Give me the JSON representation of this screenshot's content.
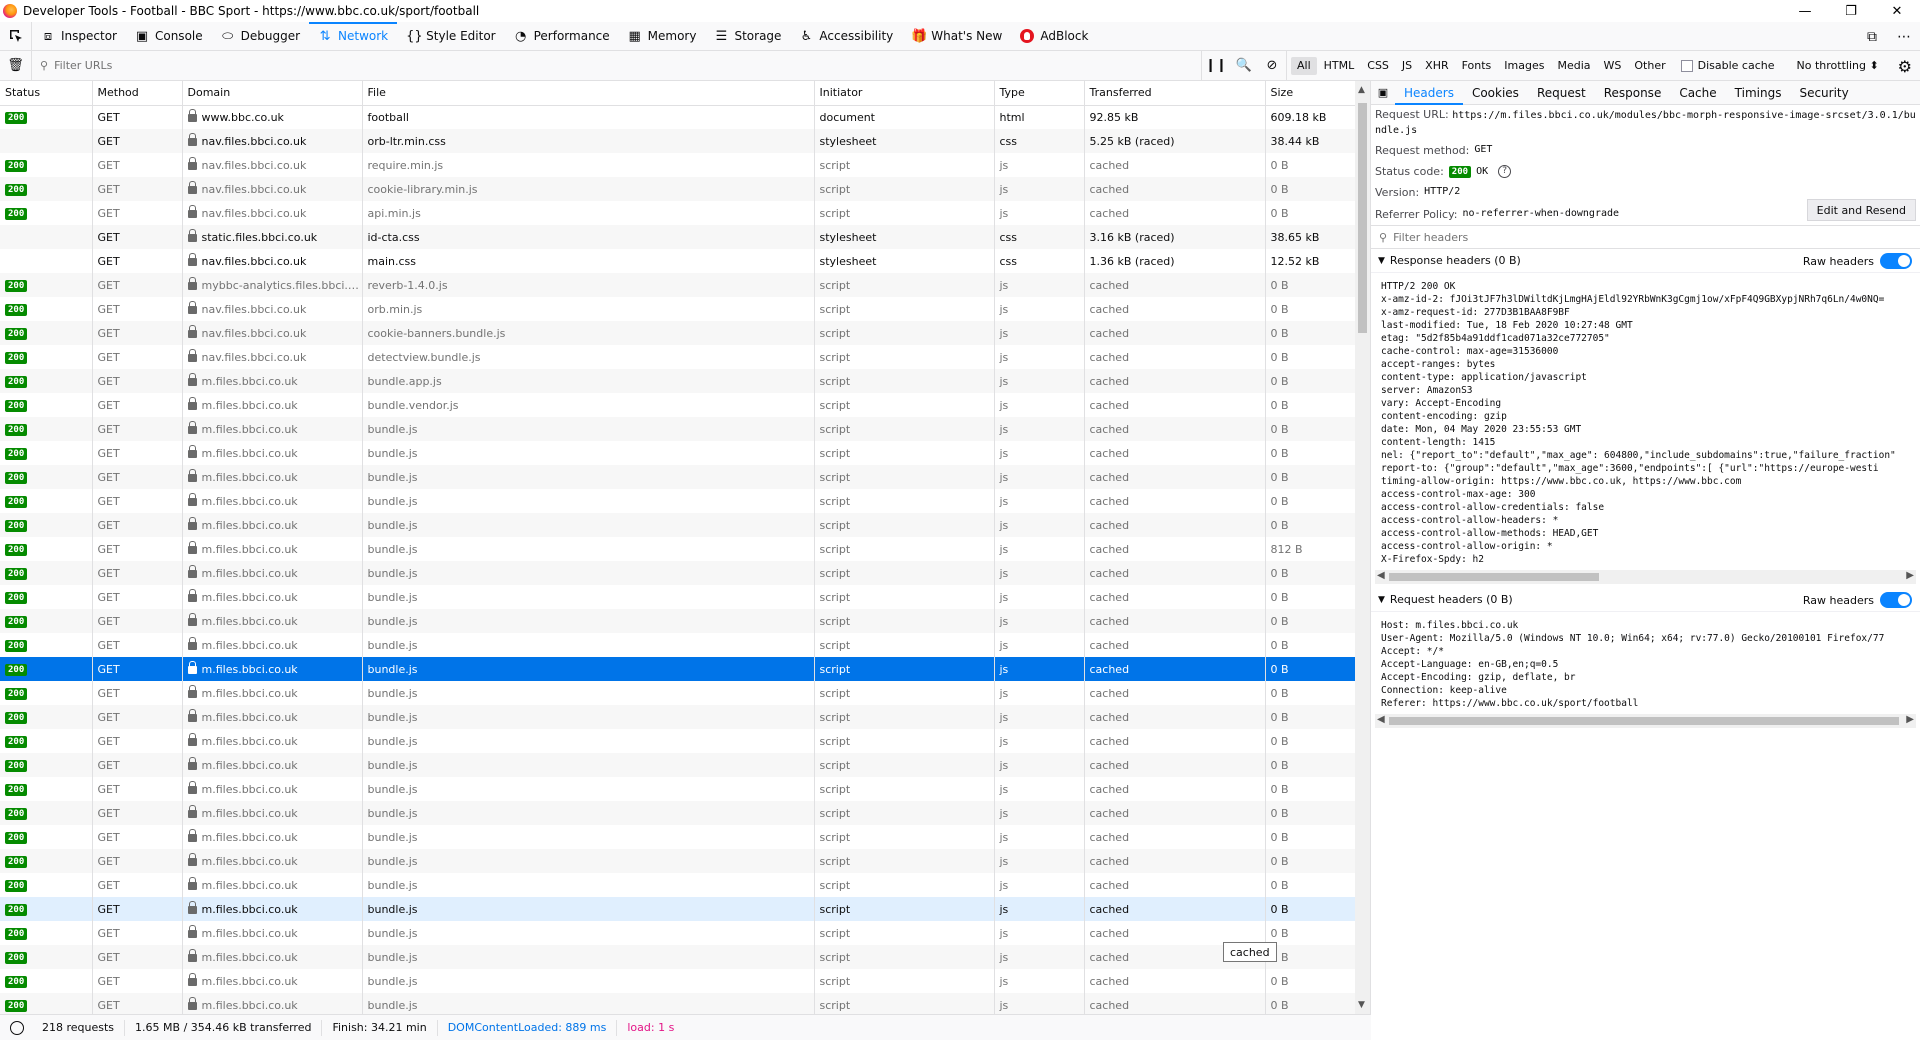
{
  "window": {
    "title": "Developer Tools - Football - BBC Sport - https://www.bbc.co.uk/sport/football",
    "minimize": "—",
    "restore": "❐",
    "close": "✕"
  },
  "toolbox": {
    "tabs": [
      {
        "label": "Inspector",
        "icon": "⧈"
      },
      {
        "label": "Console",
        "icon": "▣"
      },
      {
        "label": "Debugger",
        "icon": "⬭"
      },
      {
        "label": "Network",
        "icon": "⇅"
      },
      {
        "label": "Style Editor",
        "icon": "{}"
      },
      {
        "label": "Performance",
        "icon": "◔"
      },
      {
        "label": "Memory",
        "icon": "▦"
      },
      {
        "label": "Storage",
        "icon": "☰"
      },
      {
        "label": "Accessibility",
        "icon": "♿"
      },
      {
        "label": "What's New",
        "icon": "🎁"
      },
      {
        "label": "AdBlock",
        "icon": ""
      }
    ],
    "selected": "Network"
  },
  "network_toolbar": {
    "filter_placeholder": "Filter URLs",
    "types": [
      "All",
      "HTML",
      "CSS",
      "JS",
      "XHR",
      "Fonts",
      "Images",
      "Media",
      "WS",
      "Other"
    ],
    "active_type": "All",
    "disable_cache": "Disable cache",
    "throttling": "No throttling ⬍"
  },
  "columns": [
    "Status",
    "Method",
    "Domain",
    "File",
    "Initiator",
    "Type",
    "Transferred",
    "Size"
  ],
  "requests": [
    {
      "status": "200",
      "method": "GET",
      "domain": "www.bbc.co.uk",
      "file": "football",
      "initiator": "document",
      "type": "html",
      "transferred": "92.85 kB",
      "size": "609.18 kB",
      "fresh": true
    },
    {
      "status": "",
      "method": "GET",
      "domain": "nav.files.bbci.co.uk",
      "file": "orb-ltr.min.css",
      "initiator": "stylesheet",
      "type": "css",
      "transferred": "5.25 kB (raced)",
      "size": "38.44 kB",
      "fresh": true
    },
    {
      "status": "200",
      "method": "GET",
      "domain": "nav.files.bbci.co.uk",
      "file": "require.min.js",
      "initiator": "script",
      "type": "js",
      "transferred": "cached",
      "size": "0 B"
    },
    {
      "status": "200",
      "method": "GET",
      "domain": "nav.files.bbci.co.uk",
      "file": "cookie-library.min.js",
      "initiator": "script",
      "type": "js",
      "transferred": "cached",
      "size": "0 B"
    },
    {
      "status": "200",
      "method": "GET",
      "domain": "nav.files.bbci.co.uk",
      "file": "api.min.js",
      "initiator": "script",
      "type": "js",
      "transferred": "cached",
      "size": "0 B"
    },
    {
      "status": "",
      "method": "GET",
      "domain": "static.files.bbci.co.uk",
      "file": "id-cta.css",
      "initiator": "stylesheet",
      "type": "css",
      "transferred": "3.16 kB (raced)",
      "size": "38.65 kB",
      "fresh": true
    },
    {
      "status": "",
      "method": "GET",
      "domain": "nav.files.bbci.co.uk",
      "file": "main.css",
      "initiator": "stylesheet",
      "type": "css",
      "transferred": "1.36 kB (raced)",
      "size": "12.52 kB",
      "fresh": true
    },
    {
      "status": "200",
      "method": "GET",
      "domain": "mybbc-analytics.files.bbci.co...",
      "file": "reverb-1.4.0.js",
      "initiator": "script",
      "type": "js",
      "transferred": "cached",
      "size": "0 B"
    },
    {
      "status": "200",
      "method": "GET",
      "domain": "nav.files.bbci.co.uk",
      "file": "orb.min.js",
      "initiator": "script",
      "type": "js",
      "transferred": "cached",
      "size": "0 B"
    },
    {
      "status": "200",
      "method": "GET",
      "domain": "nav.files.bbci.co.uk",
      "file": "cookie-banners.bundle.js",
      "initiator": "script",
      "type": "js",
      "transferred": "cached",
      "size": "0 B"
    },
    {
      "status": "200",
      "method": "GET",
      "domain": "nav.files.bbci.co.uk",
      "file": "detectview.bundle.js",
      "initiator": "script",
      "type": "js",
      "transferred": "cached",
      "size": "0 B"
    },
    {
      "status": "200",
      "method": "GET",
      "domain": "m.files.bbci.co.uk",
      "file": "bundle.app.js",
      "initiator": "script",
      "type": "js",
      "transferred": "cached",
      "size": "0 B"
    },
    {
      "status": "200",
      "method": "GET",
      "domain": "m.files.bbci.co.uk",
      "file": "bundle.vendor.js",
      "initiator": "script",
      "type": "js",
      "transferred": "cached",
      "size": "0 B"
    },
    {
      "status": "200",
      "method": "GET",
      "domain": "m.files.bbci.co.uk",
      "file": "bundle.js",
      "initiator": "script",
      "type": "js",
      "transferred": "cached",
      "size": "0 B"
    },
    {
      "status": "200",
      "method": "GET",
      "domain": "m.files.bbci.co.uk",
      "file": "bundle.js",
      "initiator": "script",
      "type": "js",
      "transferred": "cached",
      "size": "0 B"
    },
    {
      "status": "200",
      "method": "GET",
      "domain": "m.files.bbci.co.uk",
      "file": "bundle.js",
      "initiator": "script",
      "type": "js",
      "transferred": "cached",
      "size": "0 B"
    },
    {
      "status": "200",
      "method": "GET",
      "domain": "m.files.bbci.co.uk",
      "file": "bundle.js",
      "initiator": "script",
      "type": "js",
      "transferred": "cached",
      "size": "0 B"
    },
    {
      "status": "200",
      "method": "GET",
      "domain": "m.files.bbci.co.uk",
      "file": "bundle.js",
      "initiator": "script",
      "type": "js",
      "transferred": "cached",
      "size": "0 B"
    },
    {
      "status": "200",
      "method": "GET",
      "domain": "m.files.bbci.co.uk",
      "file": "bundle.js",
      "initiator": "script",
      "type": "js",
      "transferred": "cached",
      "size": "812 B"
    },
    {
      "status": "200",
      "method": "GET",
      "domain": "m.files.bbci.co.uk",
      "file": "bundle.js",
      "initiator": "script",
      "type": "js",
      "transferred": "cached",
      "size": "0 B"
    },
    {
      "status": "200",
      "method": "GET",
      "domain": "m.files.bbci.co.uk",
      "file": "bundle.js",
      "initiator": "script",
      "type": "js",
      "transferred": "cached",
      "size": "0 B"
    },
    {
      "status": "200",
      "method": "GET",
      "domain": "m.files.bbci.co.uk",
      "file": "bundle.js",
      "initiator": "script",
      "type": "js",
      "transferred": "cached",
      "size": "0 B"
    },
    {
      "status": "200",
      "method": "GET",
      "domain": "m.files.bbci.co.uk",
      "file": "bundle.js",
      "initiator": "script",
      "type": "js",
      "transferred": "cached",
      "size": "0 B"
    },
    {
      "status": "200",
      "method": "GET",
      "domain": "m.files.bbci.co.uk",
      "file": "bundle.js",
      "initiator": "script",
      "type": "js",
      "transferred": "cached",
      "size": "0 B",
      "selected": true
    },
    {
      "status": "200",
      "method": "GET",
      "domain": "m.files.bbci.co.uk",
      "file": "bundle.js",
      "initiator": "script",
      "type": "js",
      "transferred": "cached",
      "size": "0 B"
    },
    {
      "status": "200",
      "method": "GET",
      "domain": "m.files.bbci.co.uk",
      "file": "bundle.js",
      "initiator": "script",
      "type": "js",
      "transferred": "cached",
      "size": "0 B"
    },
    {
      "status": "200",
      "method": "GET",
      "domain": "m.files.bbci.co.uk",
      "file": "bundle.js",
      "initiator": "script",
      "type": "js",
      "transferred": "cached",
      "size": "0 B"
    },
    {
      "status": "200",
      "method": "GET",
      "domain": "m.files.bbci.co.uk",
      "file": "bundle.js",
      "initiator": "script",
      "type": "js",
      "transferred": "cached",
      "size": "0 B"
    },
    {
      "status": "200",
      "method": "GET",
      "domain": "m.files.bbci.co.uk",
      "file": "bundle.js",
      "initiator": "script",
      "type": "js",
      "transferred": "cached",
      "size": "0 B"
    },
    {
      "status": "200",
      "method": "GET",
      "domain": "m.files.bbci.co.uk",
      "file": "bundle.js",
      "initiator": "script",
      "type": "js",
      "transferred": "cached",
      "size": "0 B"
    },
    {
      "status": "200",
      "method": "GET",
      "domain": "m.files.bbci.co.uk",
      "file": "bundle.js",
      "initiator": "script",
      "type": "js",
      "transferred": "cached",
      "size": "0 B"
    },
    {
      "status": "200",
      "method": "GET",
      "domain": "m.files.bbci.co.uk",
      "file": "bundle.js",
      "initiator": "script",
      "type": "js",
      "transferred": "cached",
      "size": "0 B"
    },
    {
      "status": "200",
      "method": "GET",
      "domain": "m.files.bbci.co.uk",
      "file": "bundle.js",
      "initiator": "script",
      "type": "js",
      "transferred": "cached",
      "size": "0 B"
    },
    {
      "status": "200",
      "method": "GET",
      "domain": "m.files.bbci.co.uk",
      "file": "bundle.js",
      "initiator": "script",
      "type": "js",
      "transferred": "cached",
      "size": "0 B",
      "hover": true
    },
    {
      "status": "200",
      "method": "GET",
      "domain": "m.files.bbci.co.uk",
      "file": "bundle.js",
      "initiator": "script",
      "type": "js",
      "transferred": "cached",
      "size": "0 B"
    },
    {
      "status": "200",
      "method": "GET",
      "domain": "m.files.bbci.co.uk",
      "file": "bundle.js",
      "initiator": "script",
      "type": "js",
      "transferred": "cached",
      "size": "0 B"
    },
    {
      "status": "200",
      "method": "GET",
      "domain": "m.files.bbci.co.uk",
      "file": "bundle.js",
      "initiator": "script",
      "type": "js",
      "transferred": "cached",
      "size": "0 B"
    },
    {
      "status": "200",
      "method": "GET",
      "domain": "m.files.bbci.co.uk",
      "file": "bundle.js",
      "initiator": "script",
      "type": "js",
      "transferred": "cached",
      "size": "0 B"
    }
  ],
  "tooltip": "cached",
  "statusbar": {
    "requests": "218 requests",
    "transferred": "1.65 MB / 354.46 kB transferred",
    "finish": "Finish: 34.21 min",
    "dom": "DOMContentLoaded: 889 ms",
    "load": "load: 1 s"
  },
  "side": {
    "tabs": [
      "Headers",
      "Cookies",
      "Request",
      "Response",
      "Cache",
      "Timings",
      "Security"
    ],
    "selected": "Headers",
    "request_url_label": "Request URL:",
    "request_url": "https://m.files.bbci.co.uk/modules/bbc-morph-responsive-image-srcset/3.0.1/bundle.js",
    "method_label": "Request method:",
    "method": "GET",
    "status_label": "Status code:",
    "status_code": "200",
    "status_text": "OK",
    "version_label": "Version:",
    "version": "HTTP/2",
    "referrer_label": "Referrer Policy:",
    "referrer": "no-referrer-when-downgrade",
    "edit_resend": "Edit and Resend",
    "filter_placeholder": "Filter headers",
    "response_title": "Response headers (0 B)",
    "request_title": "Request headers (0 B)",
    "raw_label": "Raw headers",
    "response_headers": [
      "HTTP/2 200 OK",
      "x-amz-id-2: fJOi3tJF7h3lDWiltdKjLmgHAjEldl92YRbWnK3gCgmj1ow/xFpF4Q9GBXypjNRh7q6Ln/4w0NQ=",
      "x-amz-request-id: 277D3B1BAA8F9BF",
      "last-modified: Tue, 18 Feb 2020 10:27:48 GMT",
      "etag: \"5d2f85b4a91ddf1cad071a32ce772705\"",
      "cache-control: max-age=31536000",
      "accept-ranges: bytes",
      "content-type: application/javascript",
      "server: AmazonS3",
      "vary: Accept-Encoding",
      "content-encoding: gzip",
      "date: Mon, 04 May 2020 23:55:53 GMT",
      "content-length: 1415",
      "nel: {\"report_to\":\"default\",\"max_age\": 604800,\"include_subdomains\":true,\"failure_fraction\"",
      "report-to: {\"group\":\"default\",\"max_age\":3600,\"endpoints\":[ {\"url\":\"https://europe-westi",
      "timing-allow-origin: https://www.bbc.co.uk, https://www.bbc.com",
      "access-control-max-age: 300",
      "access-control-allow-credentials: false",
      "access-control-allow-headers: *",
      "access-control-allow-methods: HEAD,GET",
      "access-control-allow-origin: *",
      "X-Firefox-Spdy: h2"
    ],
    "request_headers": [
      "Host: m.files.bbci.co.uk",
      "User-Agent: Mozilla/5.0 (Windows NT 10.0; Win64; x64; rv:77.0) Gecko/20100101 Firefox/77",
      "Accept: */*",
      "Accept-Language: en-GB,en;q=0.5",
      "Accept-Encoding: gzip, deflate, br",
      "Connection: keep-alive",
      "Referer: https://www.bbc.co.uk/sport/football"
    ]
  }
}
